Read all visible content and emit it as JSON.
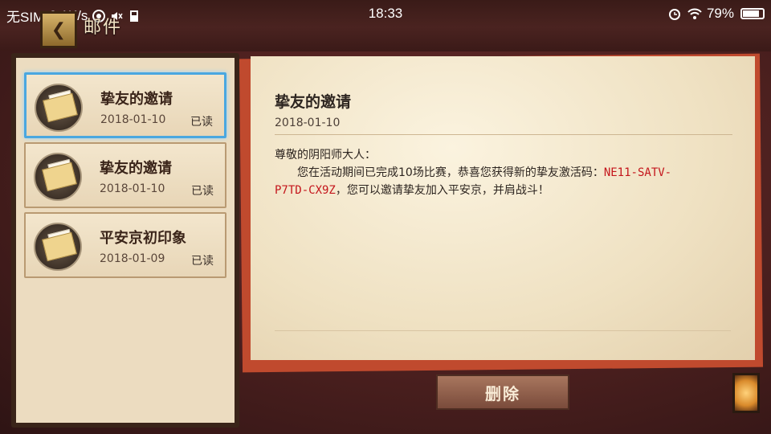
{
  "status_bar": {
    "carrier": "无SIM",
    "speed": "0.1K/s",
    "time": "18:33",
    "battery": "79%"
  },
  "header": {
    "title": "邮件",
    "back_icon": "back-arrow-icon"
  },
  "mails": [
    {
      "title": "挚友的邀请",
      "date": "2018-01-10",
      "status": "已读",
      "selected": true
    },
    {
      "title": "挚友的邀请",
      "date": "2018-01-10",
      "status": "已读",
      "selected": false
    },
    {
      "title": "平安京初印象",
      "date": "2018-01-09",
      "status": "已读",
      "selected": false
    }
  ],
  "letter": {
    "title": "挚友的邀请",
    "date": "2018-01-10",
    "greeting": "尊敬的阴阳师大人：",
    "body_1": "您在活动期间已完成10场比赛，恭喜您获得新的挚友激活码：",
    "code": "NE11-SATV-P7TD-CX9Z",
    "body_2": "，您可以邀请挚友加入平安京，并肩战斗！"
  },
  "actions": {
    "delete_label": "删除"
  },
  "colors": {
    "selected_border": "#4aa7e0",
    "code_red": "#c4161c",
    "letter_bg": "#efe1c2"
  }
}
